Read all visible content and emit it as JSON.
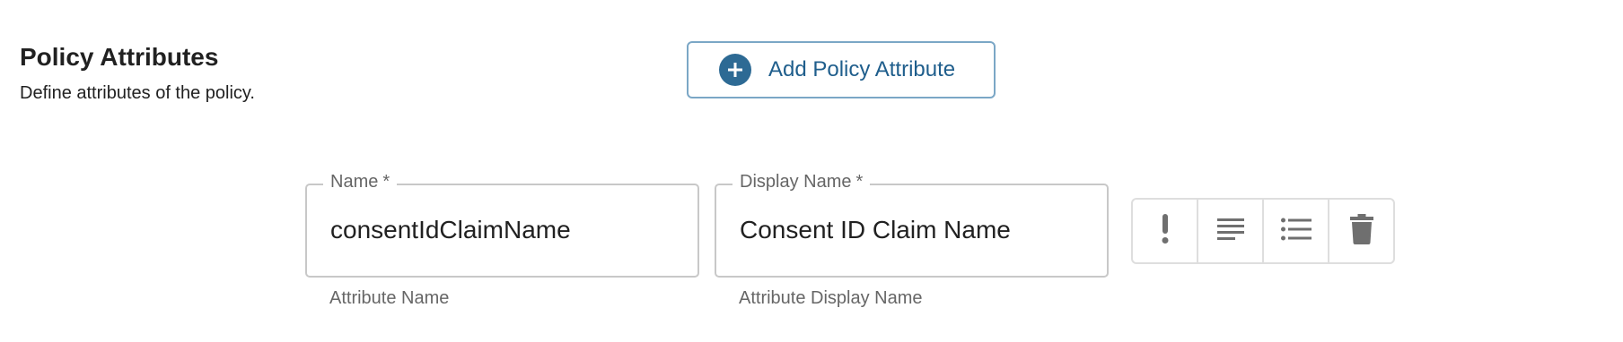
{
  "section": {
    "title": "Policy Attributes",
    "description": "Define attributes of the policy."
  },
  "add_button": {
    "label": "Add Policy Attribute",
    "icon": "plus-circle-icon",
    "accent_color": "#2d6a94"
  },
  "attribute": {
    "name_field": {
      "label": "Name",
      "required_mark": "*",
      "value": "consentIdClaimName",
      "helper": "Attribute Name"
    },
    "display_name_field": {
      "label": "Display Name",
      "required_mark": "*",
      "value": "Consent ID Claim Name",
      "helper": "Attribute Display Name"
    },
    "actions": [
      {
        "icon": "exclamation-icon"
      },
      {
        "icon": "text-lines-icon"
      },
      {
        "icon": "bulleted-list-icon"
      },
      {
        "icon": "trash-icon"
      }
    ]
  }
}
